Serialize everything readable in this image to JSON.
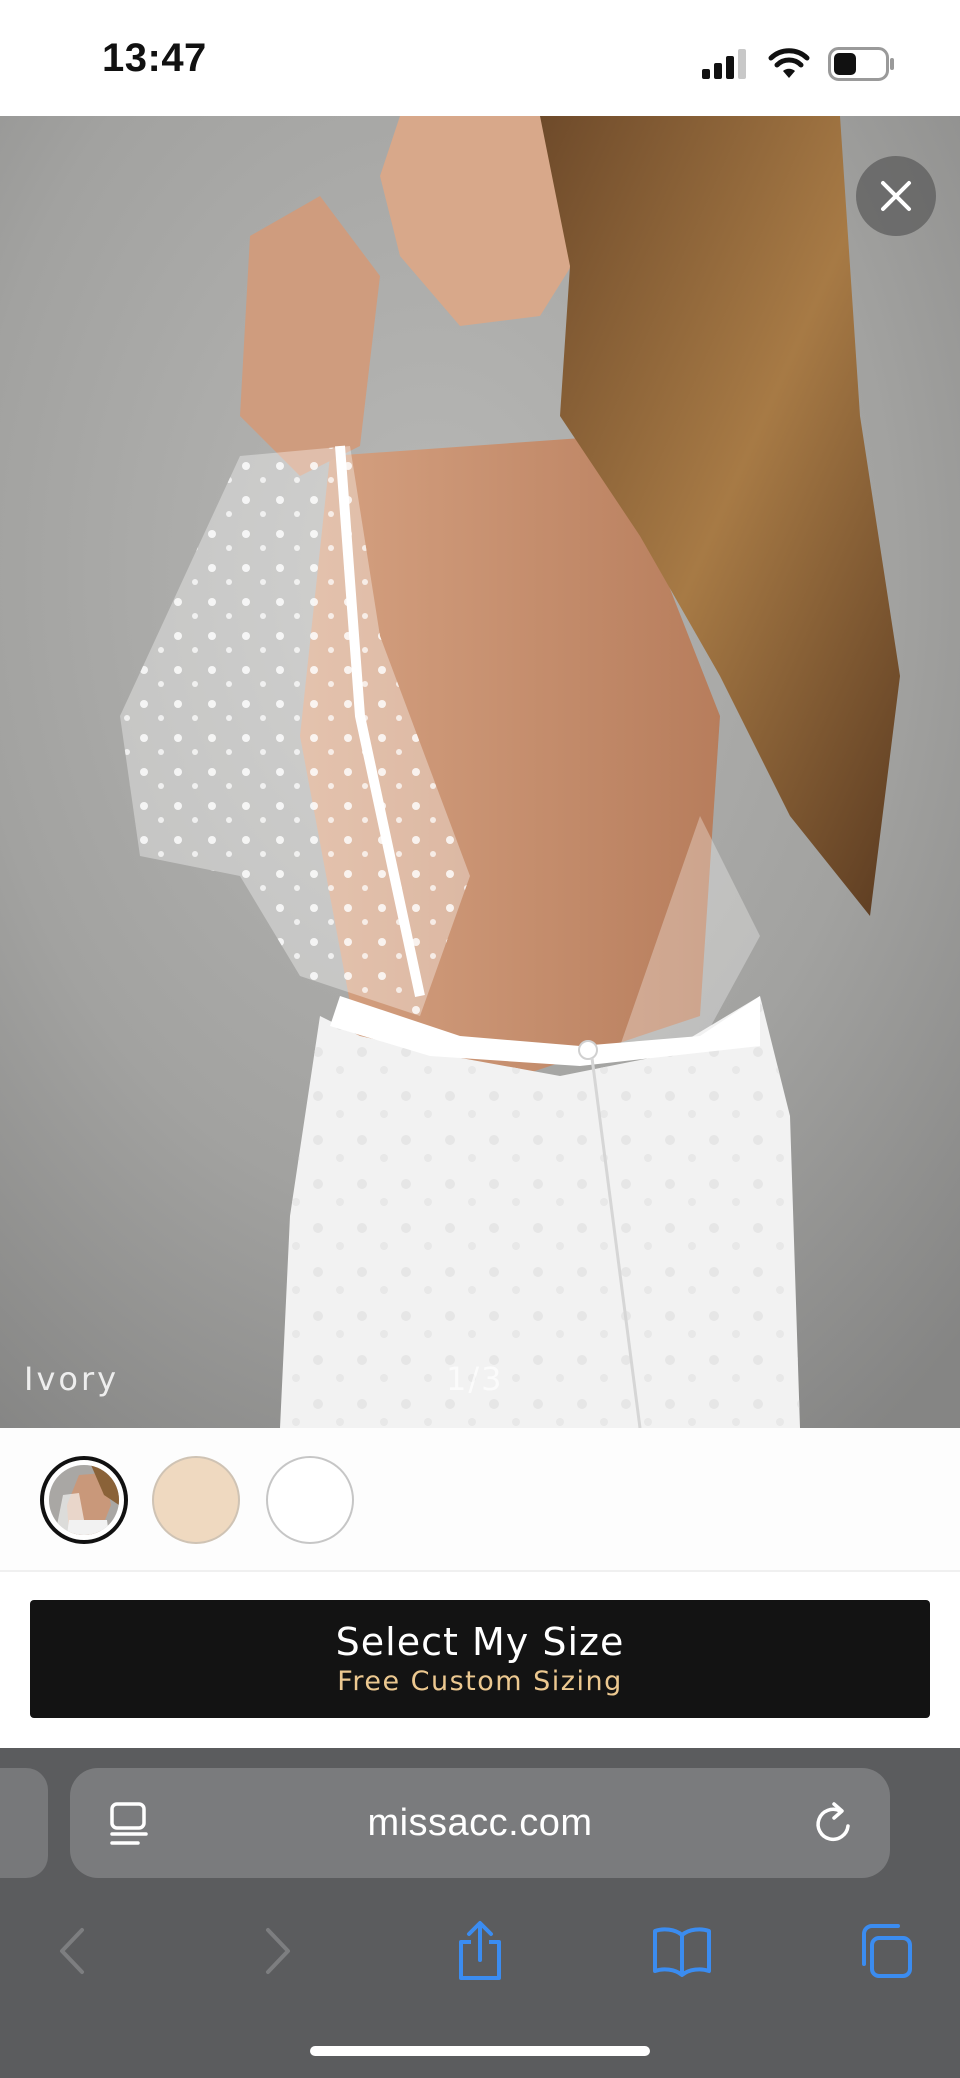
{
  "status_bar": {
    "time": "13:47",
    "icons": [
      "signal-icon",
      "wifi-icon",
      "battery-icon"
    ]
  },
  "product": {
    "color_caption": "Ivory",
    "image_counter": "1/3",
    "close_icon": "close-icon"
  },
  "swatches": [
    {
      "name": "image-swatch",
      "selected": true
    },
    {
      "name": "champagne-swatch",
      "color": "#efd9c0",
      "selected": false
    },
    {
      "name": "white-swatch",
      "color": "#ffffff",
      "selected": false
    }
  ],
  "cta": {
    "title": "Select My Size",
    "subtitle": "Free Custom Sizing",
    "subtitle_color": "#ecc890"
  },
  "browser": {
    "url": "missacc.com",
    "toolbar_icons": [
      "back-icon",
      "forward-icon",
      "share-icon",
      "bookmarks-icon",
      "tabs-icon"
    ],
    "accent_color": "#3b8cf0"
  }
}
